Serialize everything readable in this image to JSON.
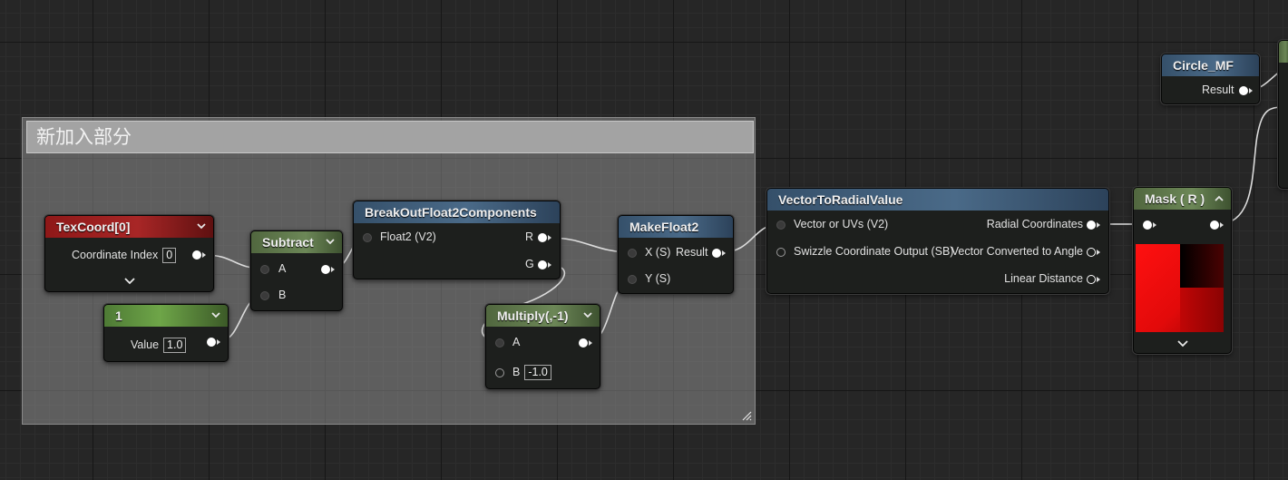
{
  "comment": {
    "title": "新加入部分"
  },
  "nodes": {
    "texcoord": {
      "title": "TexCoord[0]",
      "pin_label": "Coordinate Index",
      "value": "0"
    },
    "constant": {
      "title": "1",
      "pin_label": "Value",
      "value": "1.0"
    },
    "subtract": {
      "title": "Subtract",
      "pin_a": "A",
      "pin_b": "B"
    },
    "breakout": {
      "title": "BreakOutFloat2Components",
      "pin_in": "Float2 (V2)",
      "pin_r": "R",
      "pin_g": "G"
    },
    "multiply": {
      "title": "Multiply(,-1)",
      "pin_a": "A",
      "pin_b": "B",
      "b_value": "-1.0"
    },
    "makefloat": {
      "title": "MakeFloat2",
      "pin_x": "X (S)",
      "pin_y": "Y (S)",
      "pin_result": "Result"
    },
    "radial": {
      "title": "VectorToRadialValue",
      "in_vector": "Vector or UVs (V2)",
      "in_swizzle": "Swizzle Coordinate Output (SB)",
      "out_radial": "Radial Coordinates",
      "out_angle": "Vector Converted to Angle",
      "out_linear": "Linear Distance"
    },
    "mask": {
      "title": "Mask ( R )"
    },
    "circle": {
      "title": "Circle_MF",
      "pin_result": "Result"
    }
  },
  "colors": {
    "graph_bg": "#262626",
    "header_red": "#a82626",
    "header_green": "#6c8757",
    "header_blue": "#4a6a88",
    "wire": "#dcdcdc",
    "preview_red": "#e20a0a"
  },
  "icons": [
    "chevron-down-icon",
    "chevron-up-icon",
    "resize-grip-icon"
  ]
}
